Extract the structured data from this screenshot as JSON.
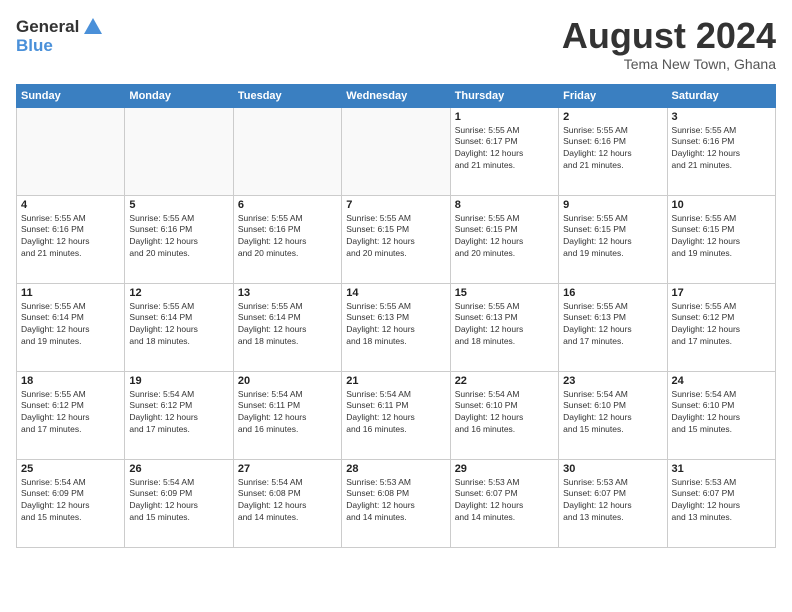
{
  "header": {
    "logo_line1": "General",
    "logo_line2": "Blue",
    "month_title": "August 2024",
    "location": "Tema New Town, Ghana"
  },
  "weekdays": [
    "Sunday",
    "Monday",
    "Tuesday",
    "Wednesday",
    "Thursday",
    "Friday",
    "Saturday"
  ],
  "weeks": [
    [
      {
        "day": "",
        "info": ""
      },
      {
        "day": "",
        "info": ""
      },
      {
        "day": "",
        "info": ""
      },
      {
        "day": "",
        "info": ""
      },
      {
        "day": "1",
        "info": "Sunrise: 5:55 AM\nSunset: 6:17 PM\nDaylight: 12 hours\nand 21 minutes."
      },
      {
        "day": "2",
        "info": "Sunrise: 5:55 AM\nSunset: 6:16 PM\nDaylight: 12 hours\nand 21 minutes."
      },
      {
        "day": "3",
        "info": "Sunrise: 5:55 AM\nSunset: 6:16 PM\nDaylight: 12 hours\nand 21 minutes."
      }
    ],
    [
      {
        "day": "4",
        "info": "Sunrise: 5:55 AM\nSunset: 6:16 PM\nDaylight: 12 hours\nand 21 minutes."
      },
      {
        "day": "5",
        "info": "Sunrise: 5:55 AM\nSunset: 6:16 PM\nDaylight: 12 hours\nand 20 minutes."
      },
      {
        "day": "6",
        "info": "Sunrise: 5:55 AM\nSunset: 6:16 PM\nDaylight: 12 hours\nand 20 minutes."
      },
      {
        "day": "7",
        "info": "Sunrise: 5:55 AM\nSunset: 6:15 PM\nDaylight: 12 hours\nand 20 minutes."
      },
      {
        "day": "8",
        "info": "Sunrise: 5:55 AM\nSunset: 6:15 PM\nDaylight: 12 hours\nand 20 minutes."
      },
      {
        "day": "9",
        "info": "Sunrise: 5:55 AM\nSunset: 6:15 PM\nDaylight: 12 hours\nand 19 minutes."
      },
      {
        "day": "10",
        "info": "Sunrise: 5:55 AM\nSunset: 6:15 PM\nDaylight: 12 hours\nand 19 minutes."
      }
    ],
    [
      {
        "day": "11",
        "info": "Sunrise: 5:55 AM\nSunset: 6:14 PM\nDaylight: 12 hours\nand 19 minutes."
      },
      {
        "day": "12",
        "info": "Sunrise: 5:55 AM\nSunset: 6:14 PM\nDaylight: 12 hours\nand 18 minutes."
      },
      {
        "day": "13",
        "info": "Sunrise: 5:55 AM\nSunset: 6:14 PM\nDaylight: 12 hours\nand 18 minutes."
      },
      {
        "day": "14",
        "info": "Sunrise: 5:55 AM\nSunset: 6:13 PM\nDaylight: 12 hours\nand 18 minutes."
      },
      {
        "day": "15",
        "info": "Sunrise: 5:55 AM\nSunset: 6:13 PM\nDaylight: 12 hours\nand 18 minutes."
      },
      {
        "day": "16",
        "info": "Sunrise: 5:55 AM\nSunset: 6:13 PM\nDaylight: 12 hours\nand 17 minutes."
      },
      {
        "day": "17",
        "info": "Sunrise: 5:55 AM\nSunset: 6:12 PM\nDaylight: 12 hours\nand 17 minutes."
      }
    ],
    [
      {
        "day": "18",
        "info": "Sunrise: 5:55 AM\nSunset: 6:12 PM\nDaylight: 12 hours\nand 17 minutes."
      },
      {
        "day": "19",
        "info": "Sunrise: 5:54 AM\nSunset: 6:12 PM\nDaylight: 12 hours\nand 17 minutes."
      },
      {
        "day": "20",
        "info": "Sunrise: 5:54 AM\nSunset: 6:11 PM\nDaylight: 12 hours\nand 16 minutes."
      },
      {
        "day": "21",
        "info": "Sunrise: 5:54 AM\nSunset: 6:11 PM\nDaylight: 12 hours\nand 16 minutes."
      },
      {
        "day": "22",
        "info": "Sunrise: 5:54 AM\nSunset: 6:10 PM\nDaylight: 12 hours\nand 16 minutes."
      },
      {
        "day": "23",
        "info": "Sunrise: 5:54 AM\nSunset: 6:10 PM\nDaylight: 12 hours\nand 15 minutes."
      },
      {
        "day": "24",
        "info": "Sunrise: 5:54 AM\nSunset: 6:10 PM\nDaylight: 12 hours\nand 15 minutes."
      }
    ],
    [
      {
        "day": "25",
        "info": "Sunrise: 5:54 AM\nSunset: 6:09 PM\nDaylight: 12 hours\nand 15 minutes."
      },
      {
        "day": "26",
        "info": "Sunrise: 5:54 AM\nSunset: 6:09 PM\nDaylight: 12 hours\nand 15 minutes."
      },
      {
        "day": "27",
        "info": "Sunrise: 5:54 AM\nSunset: 6:08 PM\nDaylight: 12 hours\nand 14 minutes."
      },
      {
        "day": "28",
        "info": "Sunrise: 5:53 AM\nSunset: 6:08 PM\nDaylight: 12 hours\nand 14 minutes."
      },
      {
        "day": "29",
        "info": "Sunrise: 5:53 AM\nSunset: 6:07 PM\nDaylight: 12 hours\nand 14 minutes."
      },
      {
        "day": "30",
        "info": "Sunrise: 5:53 AM\nSunset: 6:07 PM\nDaylight: 12 hours\nand 13 minutes."
      },
      {
        "day": "31",
        "info": "Sunrise: 5:53 AM\nSunset: 6:07 PM\nDaylight: 12 hours\nand 13 minutes."
      }
    ]
  ]
}
